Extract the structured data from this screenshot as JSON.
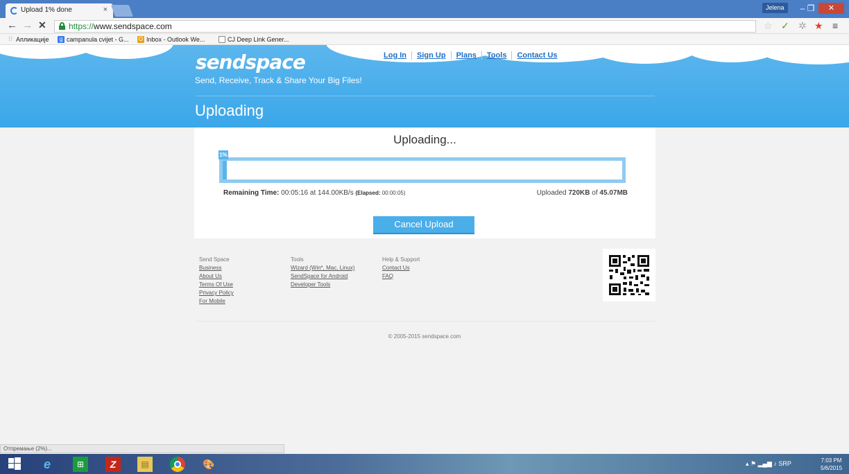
{
  "browser": {
    "tab_title": "Upload 1% done",
    "tab_close": "×",
    "user": "Jelena",
    "url_scheme": "https://",
    "url_host": "www.sendspace.com",
    "bookmarks": [
      "Апликације",
      "campanula cvijet - G...",
      "Inbox - Outlook We...",
      "CJ Deep Link Gener..."
    ],
    "status": "Отпремање (2%)..."
  },
  "site": {
    "logo": "sendspace",
    "tagline": "Send, Receive, Track & Share Your Big Files!",
    "nav": [
      "Log In",
      "Sign Up",
      "Plans",
      "Tools",
      "Contact Us"
    ],
    "page_title": "Uploading"
  },
  "upload": {
    "heading": "Uploading...",
    "percent_label": "1%",
    "progress": 0.01,
    "remaining_label": "Remaining Time:",
    "remaining": "00:05:16 at 144.00KB/s",
    "elapsed_label": "(Elapsed:",
    "elapsed": "00:00:05)",
    "uploaded_prefix": "Uploaded",
    "uploaded": "720KB",
    "of": "of",
    "total": "45.07MB",
    "cancel": "Cancel Upload"
  },
  "footer": {
    "col1": {
      "heading": "Send Space",
      "links": [
        "Business",
        "About Us",
        "Terms Of Use",
        "Privacy Policy",
        "For Mobile"
      ]
    },
    "col2": {
      "heading": "Tools",
      "links": [
        "Wizard (Win*, Mac, Linux)",
        "SendSpace for Android",
        "Developer Tools"
      ]
    },
    "col3": {
      "heading": "Help & Support",
      "links": [
        "Contact Us",
        "FAQ"
      ]
    },
    "copyright": "© 2005-2015 sendspace.com"
  },
  "taskbar": {
    "lang": "SRP",
    "time": "7:03 PM",
    "date": "5/6/2015"
  },
  "colors": {
    "accent": "#3aa7ea",
    "progress": "#5ab4ea",
    "close": "#c94737"
  }
}
